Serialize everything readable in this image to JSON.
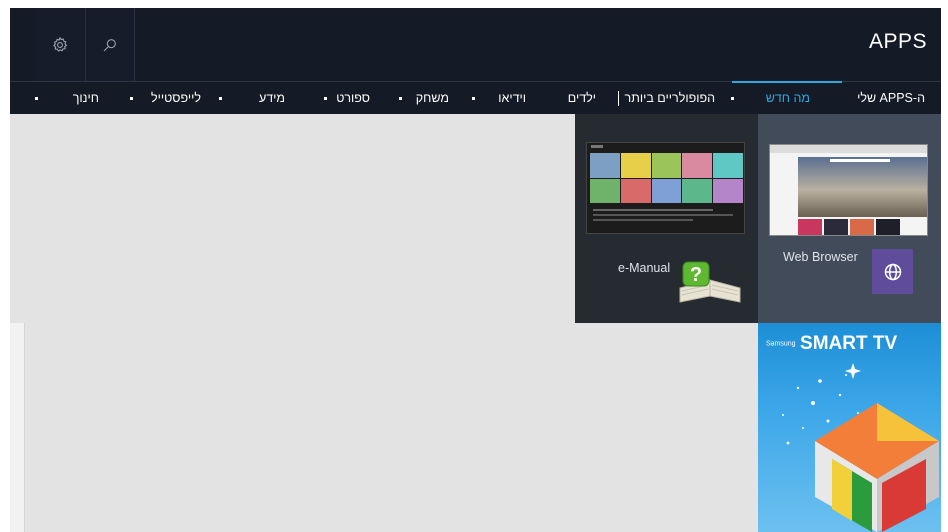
{
  "header": {
    "title": "APPS",
    "settings_icon": "gear-icon",
    "search_icon": "search-icon"
  },
  "nav": {
    "items": [
      {
        "label": "ה-APPS שלי",
        "active": false
      },
      {
        "label": "מה חדש",
        "active": true
      },
      {
        "label": "הפופולריים ביותר",
        "active": false
      },
      {
        "label": "ילדים",
        "active": false
      },
      {
        "label": "וידיאו",
        "active": false
      },
      {
        "label": "משחק",
        "active": false
      },
      {
        "label": "ספורט",
        "active": false
      },
      {
        "label": "מידע",
        "active": false
      },
      {
        "label": "לייפסטייל",
        "active": false
      },
      {
        "label": "חינוך",
        "active": false
      }
    ]
  },
  "tiles": {
    "web_browser": {
      "label": "Web Browser",
      "icon": "globe-icon"
    },
    "e_manual": {
      "label": "e-Manual",
      "icon": "help-book-icon"
    },
    "samsung": {
      "brand": "Samsung",
      "logo": "SMART TV"
    }
  },
  "colors": {
    "background": "#141a26",
    "accent": "#2fa8e0",
    "content": "#e3e3e3",
    "web_browser_icon": "#5f4d9c"
  }
}
